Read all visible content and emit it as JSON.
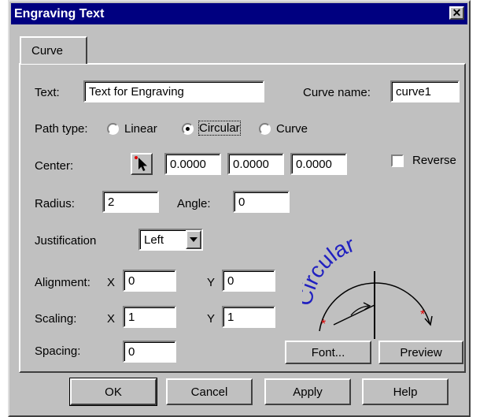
{
  "window": {
    "title": "Engraving Text",
    "close_glyph": "✕"
  },
  "tabs": [
    {
      "label": "Curve"
    }
  ],
  "form": {
    "text_label": "Text:",
    "text_value": "Text for Engraving",
    "curve_name_label": "Curve name:",
    "curve_name_value": "curve1",
    "path_type_label": "Path type:",
    "path_options": [
      "Linear",
      "Circular",
      "Curve"
    ],
    "path_selected": "Circular",
    "center_label": "Center:",
    "center_values": [
      "0.0000",
      "0.0000",
      "0.0000"
    ],
    "reverse_label": "Reverse",
    "reverse_checked": false,
    "radius_label": "Radius:",
    "radius_value": "2",
    "angle_label": "Angle:",
    "angle_value": "0",
    "justification_label": "Justification",
    "justification_value": "Left",
    "alignment_label": "Alignment:",
    "alignment_x_label": "X",
    "alignment_x": "0",
    "alignment_y_label": "Y",
    "alignment_y": "0",
    "scaling_label": "Scaling:",
    "scaling_x_label": "X",
    "scaling_x": "1",
    "scaling_y_label": "Y",
    "scaling_y": "1",
    "spacing_label": "Spacing:",
    "spacing_value": "0"
  },
  "preview_art_text": "Circular",
  "buttons": {
    "font": "Font...",
    "preview": "Preview",
    "ok": "OK",
    "cancel": "Cancel",
    "apply": "Apply",
    "help": "Help"
  },
  "colors": {
    "titlebar": "#000080",
    "art_text": "#2020c0",
    "art_marker": "#e00000"
  },
  "icons": {
    "pick_point": "arrow-cursor-icon",
    "dropdown": "chevron-down-icon",
    "close": "close-icon"
  }
}
